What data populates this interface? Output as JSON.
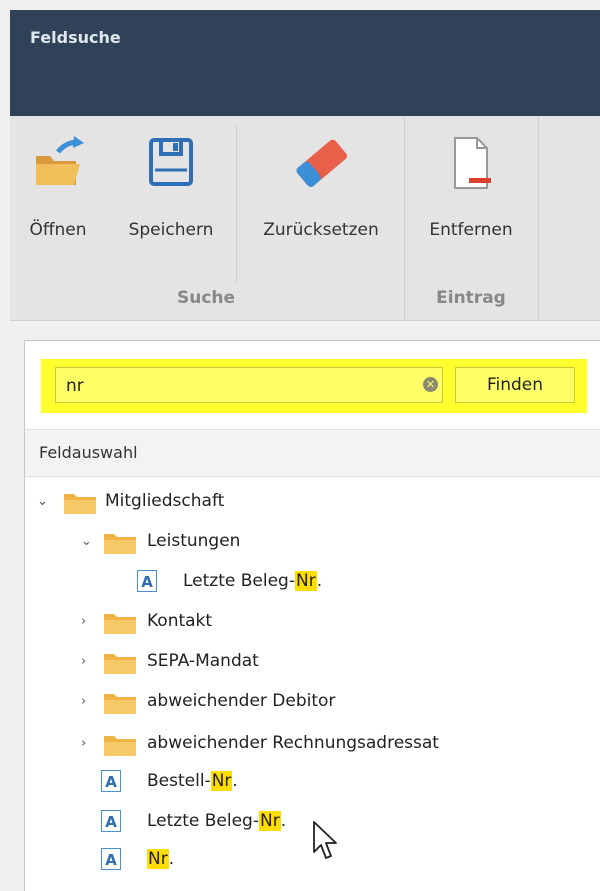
{
  "window": {
    "title": "Feldsuche"
  },
  "ribbon": {
    "buttons": {
      "open": "Öffnen",
      "save": "Speichern",
      "reset": "Zurücksetzen",
      "remove": "Entfernen"
    },
    "groups": {
      "suche": "Suche",
      "eintrag": "Eintrag"
    }
  },
  "search": {
    "value": "nr",
    "button": "Finden"
  },
  "section": {
    "title": "Feldauswahl"
  },
  "tree": {
    "root": "Mitgliedschaft",
    "leistungen": "Leistungen",
    "leistungen_item": {
      "prefix": "Letzte Beleg-",
      "match": "Nr",
      "suffix": "."
    },
    "kontakt": "Kontakt",
    "sepa": "SEPA-Mandat",
    "debitor": "abweichender Debitor",
    "rechnung": "abweichender Rechnungsadressat",
    "bestell": {
      "prefix": "Bestell-",
      "match": "Nr",
      "suffix": "."
    },
    "letzte": {
      "prefix": "Letzte Beleg-",
      "match": "Nr",
      "suffix": "."
    },
    "nr": {
      "prefix": "",
      "match": "Nr",
      "suffix": "."
    },
    "field_type_letter": "A"
  },
  "colors": {
    "title_bg": "#2f4257",
    "highlight": "#ffff2e",
    "match": "#ffdd00",
    "field_icon": "#4a8fd0"
  }
}
